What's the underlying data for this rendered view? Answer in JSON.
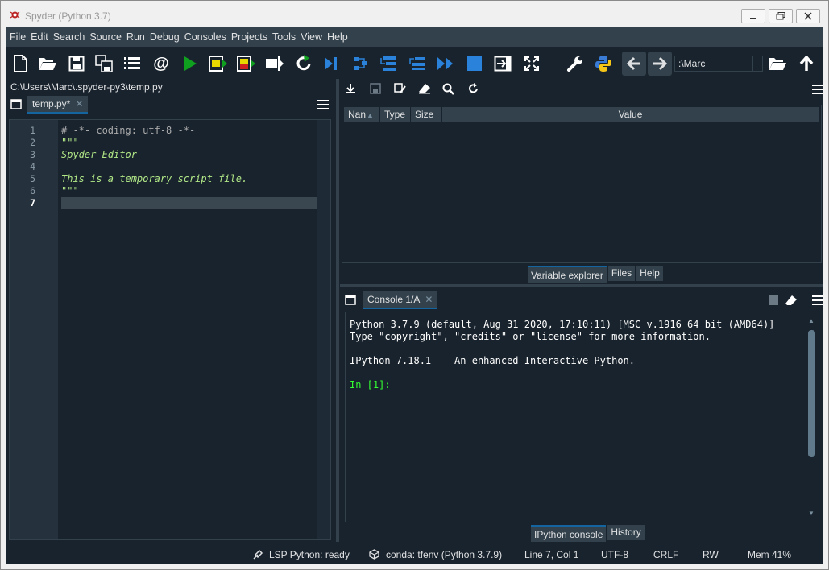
{
  "window": {
    "title": "Spyder (Python 3.7)"
  },
  "menu": {
    "items": [
      "File",
      "Edit",
      "Search",
      "Source",
      "Run",
      "Debug",
      "Consoles",
      "Projects",
      "Tools",
      "View",
      "Help"
    ]
  },
  "toolbar": {
    "working_dir": ":\\Marc",
    "icons": [
      "new-file-icon",
      "open-folder-icon",
      "save-icon",
      "save-all-icon",
      "list-icon",
      "at-icon",
      "run-icon",
      "run-cell-icon",
      "run-cell-advance-icon",
      "run-selection-icon",
      "rerun-icon",
      "debug-icon",
      "step-icon",
      "step-into-icon",
      "step-return-icon",
      "continue-icon",
      "stop-icon",
      "maximize-pane-icon",
      "fullscreen-icon",
      "wrench-icon",
      "python-icon",
      "back-arrow-icon",
      "forward-arrow-icon",
      "browse-folder-icon",
      "up-arrow-icon"
    ],
    "colors": {
      "run": "#10a020",
      "stop": "#2a82da",
      "accent": "#1464a0"
    }
  },
  "editor": {
    "file_path": "C:\\Users\\Marc\\.spyder-py3\\temp.py",
    "tab_label": "temp.py*",
    "line_numbers": [
      "1",
      "2",
      "3",
      "4",
      "5",
      "6",
      "7"
    ],
    "lines": [
      {
        "text": "# -*- coding: utf-8 -*-",
        "kind": "comment"
      },
      {
        "text": "\"\"\"",
        "kind": "string"
      },
      {
        "text": "Spyder Editor",
        "kind": "string"
      },
      {
        "text": "",
        "kind": "string"
      },
      {
        "text": "This is a temporary script file.",
        "kind": "string"
      },
      {
        "text": "\"\"\"",
        "kind": "string"
      },
      {
        "text": "",
        "kind": "plain"
      }
    ]
  },
  "variable_explorer": {
    "columns": [
      "Nan",
      "Type",
      "Size",
      "Value"
    ],
    "tabs": [
      "Variable explorer",
      "Files",
      "Help"
    ]
  },
  "console": {
    "tab_label": "Console 1/A",
    "lines": [
      "Python 3.7.9 (default, Aug 31 2020, 17:10:11) [MSC v.1916 64 bit (AMD64)]",
      "Type \"copyright\", \"credits\" or \"license\" for more information.",
      "",
      "IPython 7.18.1 -- An enhanced Interactive Python.",
      ""
    ],
    "prompt": "In [1]:",
    "tabs": [
      "IPython console",
      "History"
    ]
  },
  "status": {
    "lsp": "LSP Python: ready",
    "conda": "conda: tfenv (Python 3.7.9)",
    "position": "Line 7, Col 1",
    "encoding": "UTF-8",
    "eol": "CRLF",
    "mode": "RW",
    "memory": "Mem 41%"
  }
}
